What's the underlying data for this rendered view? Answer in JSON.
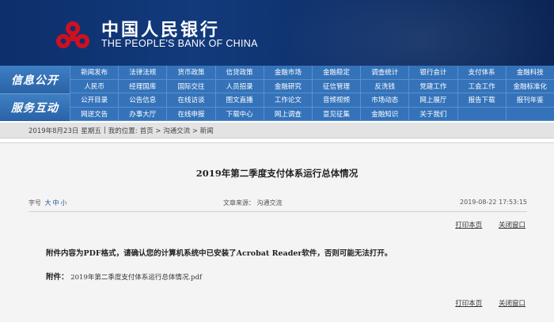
{
  "header": {
    "logo_cn": "中国人民银行",
    "logo_en": "THE PEOPLE'S BANK OF CHINA",
    "brand_color": "#c8102e"
  },
  "nav": {
    "side_labels": [
      "信息公开",
      "服务互动"
    ],
    "rows": [
      [
        "新闻发布",
        "法律法规",
        "货币政策",
        "信贷政策",
        "金融市场",
        "金融稳定",
        "调查统计",
        "银行会计",
        "支付体系",
        "金融科技"
      ],
      [
        "人民币",
        "经理国库",
        "国际交往",
        "人员招录",
        "金融研究",
        "征信管理",
        "反洗钱",
        "党建工作",
        "工会工作",
        "金融标准化"
      ],
      [
        "公开目录",
        "公告信息",
        "在线访谈",
        "图文直播",
        "工作论文",
        "音频视频",
        "市场动态",
        "网上展厅",
        "报告下载",
        "报刊年鉴"
      ],
      [
        "网送文告",
        "办事大厅",
        "在线申报",
        "下载中心",
        "网上调查",
        "意见征集",
        "金融知识",
        "关于我们",
        "",
        ""
      ]
    ]
  },
  "breadcrumb": {
    "date": "2019年8月23日",
    "weekday": "星期五",
    "divider": "|",
    "location_label": "我的位置:",
    "path": "首页 > 沟通交流 > 新闻"
  },
  "article": {
    "title": "2019年第二季度支付体系运行总体情况",
    "font_size_label": "字号",
    "font_sizes": [
      "大",
      "中",
      "小"
    ],
    "source": "文章来源：  沟通交流",
    "datetime": "2019-08-22 17:53:15",
    "print_label": "打印本页",
    "close_label": "关闭窗口",
    "notice": "附件内容为PDF格式，请确认您的计算机系统中已安装了Acrobat Reader软件，否则可能无法打开。",
    "attachment_label": "附件：",
    "attachment_name": "2019年第二季度支付体系运行总体情况.pdf"
  }
}
